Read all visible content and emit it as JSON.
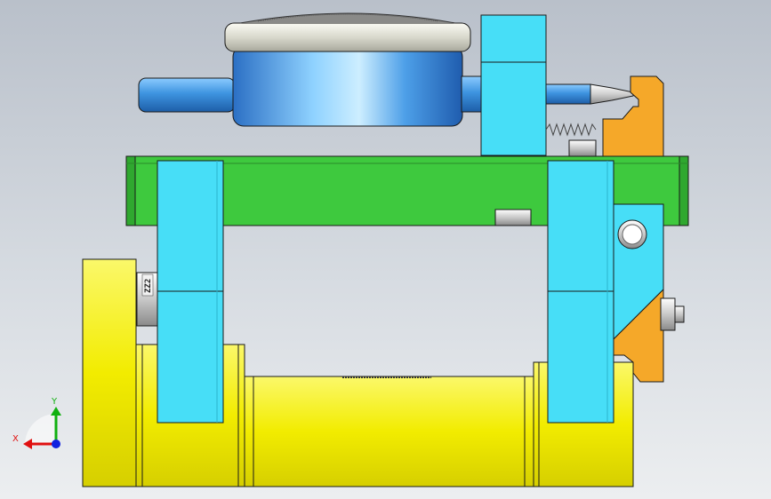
{
  "scene": {
    "background_top": "#b9c0ca",
    "background_bottom": "#eceef0",
    "edge_color": "#1a1a1a"
  },
  "colors": {
    "gauge_body": "#4fa6f0",
    "gauge_bezel": "#e4e4dc",
    "spindle": "#4aa3ea",
    "clamp_block": "#47def7",
    "base_plate": "#3ec93e",
    "roller": "#f4f000",
    "bracket": "#f5a829",
    "bushing": "#d4d4d4"
  },
  "part_labels": {
    "bearing_mark": "ZZ2"
  },
  "triad": {
    "x_label": "X",
    "y_label": "Y",
    "x_color": "#e01010",
    "y_color": "#10b010",
    "z_color": "#1020e0"
  }
}
